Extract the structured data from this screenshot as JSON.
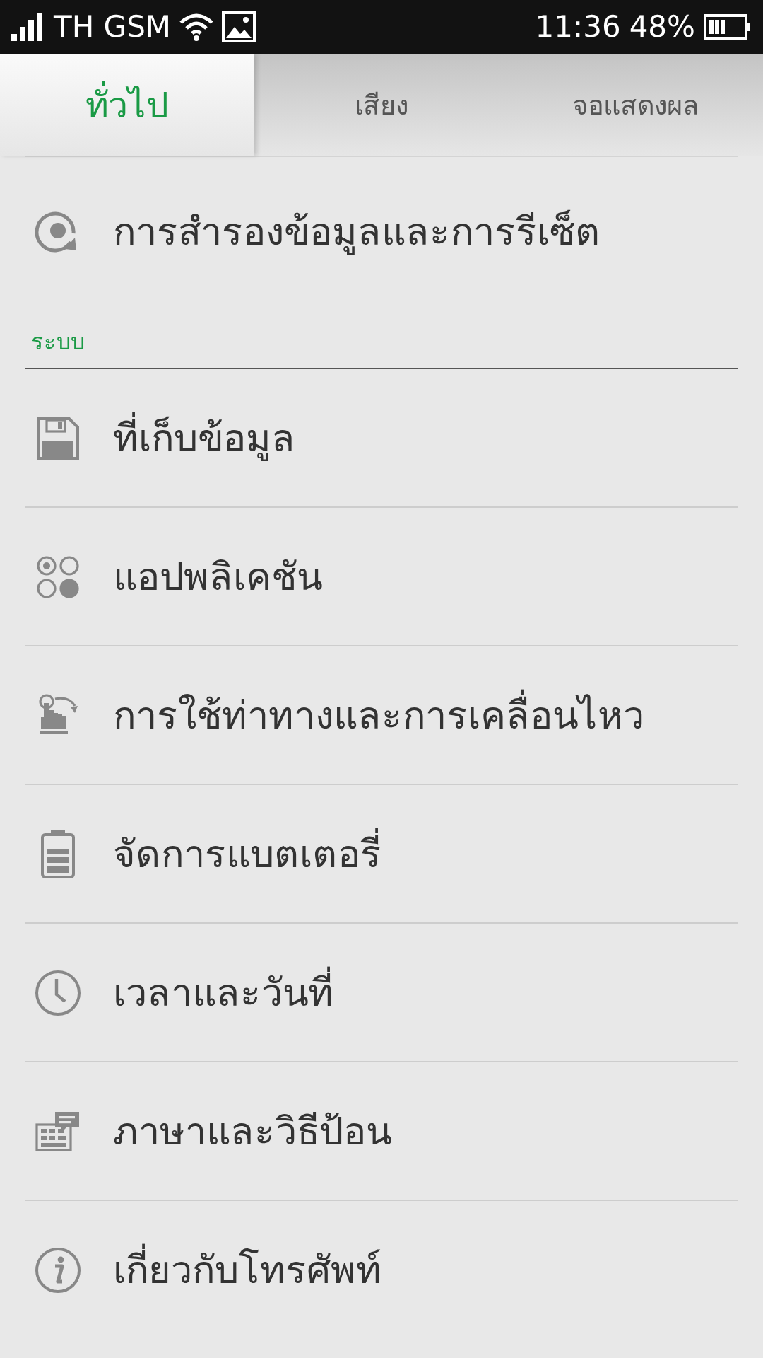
{
  "status_bar": {
    "carrier": "TH GSM",
    "time": "11:36",
    "battery": "48%"
  },
  "tabs": [
    {
      "label": "ทั่วไป",
      "selected": true
    },
    {
      "label": "เสียง",
      "selected": false
    },
    {
      "label": "จอแสดงผล",
      "selected": false
    }
  ],
  "top_items": [
    {
      "label": "การสำรองข้อมูลและการรีเซ็ต"
    }
  ],
  "section": {
    "title": "ระบบ",
    "items": [
      {
        "label": "ที่เก็บข้อมูล"
      },
      {
        "label": "แอปพลิเคชัน"
      },
      {
        "label": "การใช้ท่าทางและการเคลื่อนไหว"
      },
      {
        "label": "จัดการแบตเตอรี่"
      },
      {
        "label": "เวลาและวันที่"
      },
      {
        "label": "ภาษาและวิธีป้อน"
      },
      {
        "label": "เกี่ยวกับโทรศัพท์"
      }
    ]
  }
}
